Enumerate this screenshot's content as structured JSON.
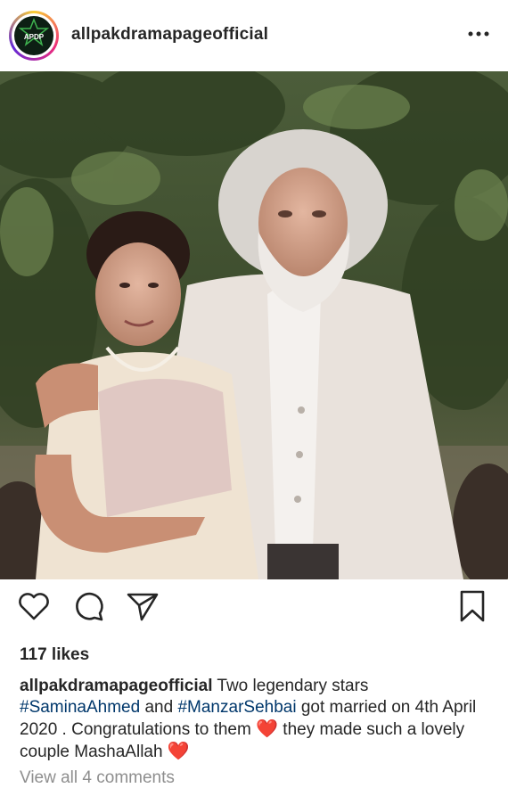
{
  "header": {
    "avatar_text": "APDP",
    "username": "allpakdramapageofficial",
    "more_label": "•••"
  },
  "post": {
    "likes": "117 likes",
    "caption": {
      "username": "allpakdramapageofficial",
      "text_1": " Two legendary stars ",
      "hashtag_1": "#SaminaAhmed",
      "text_2": "  and ",
      "hashtag_2": "#ManzarSehbai",
      "text_3": " got married on 4th April 2020 . Congratulations to them ",
      "emoji_1": "❤️",
      "text_4": " they made such a lovely couple MashaAllah ",
      "emoji_2": "❤️"
    },
    "view_comments": "View all 4 comments"
  },
  "icons": {
    "like": "heart-icon",
    "comment": "comment-icon",
    "share": "send-icon",
    "save": "bookmark-icon",
    "more": "more-icon"
  }
}
